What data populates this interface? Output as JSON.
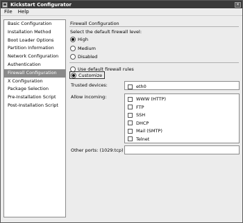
{
  "window": {
    "title": "Kickstart Configurator"
  },
  "menubar": [
    {
      "label": "File"
    },
    {
      "label": "Help"
    }
  ],
  "sidebar": {
    "items": [
      {
        "label": "Basic Configuration"
      },
      {
        "label": "Installation Method"
      },
      {
        "label": "Boot Loader Options"
      },
      {
        "label": "Partition Information"
      },
      {
        "label": "Network Configuration"
      },
      {
        "label": "Authentication"
      },
      {
        "label": "Firewall Configuration",
        "selected": true
      },
      {
        "label": "X Configuration"
      },
      {
        "label": "Package Selection"
      },
      {
        "label": "Pre-Installation Script"
      },
      {
        "label": "Post-Installation Script"
      }
    ]
  },
  "firewall": {
    "section_title": "Firewall Configuration",
    "level_prompt": "Select the default firewall level:",
    "levels": [
      {
        "label": "High",
        "selected": true
      },
      {
        "label": "Medium",
        "selected": false
      },
      {
        "label": "Disabled",
        "selected": false
      }
    ],
    "rules_options": [
      {
        "label": "Use default firewall rules",
        "selected": false
      },
      {
        "label": "Customize",
        "selected": true
      }
    ],
    "trusted_devices_label": "Trusted devices:",
    "trusted_devices": [
      {
        "label": "eth0",
        "checked": false
      }
    ],
    "allow_incoming_label": "Allow incoming:",
    "allow_incoming": [
      {
        "label": "WWW (HTTP)",
        "checked": false
      },
      {
        "label": "FTP",
        "checked": false
      },
      {
        "label": "SSH",
        "checked": false
      },
      {
        "label": "DHCP",
        "checked": false
      },
      {
        "label": "Mail (SMTP)",
        "checked": false
      },
      {
        "label": "Telnet",
        "checked": false
      }
    ],
    "other_ports_label": "Other ports: (1029:tcp)",
    "other_ports_value": ""
  }
}
